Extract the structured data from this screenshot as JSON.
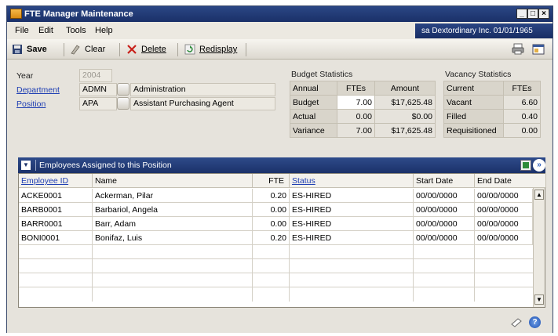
{
  "window": {
    "title": "FTE Manager Maintenance",
    "controls": [
      "_",
      "□",
      "×"
    ]
  },
  "menu": {
    "items": [
      "File",
      "Edit",
      "Tools",
      "Help"
    ],
    "user_info": "sa  Dextordinary Inc.  01/01/1965"
  },
  "toolbar": {
    "save": "Save",
    "clear": "Clear",
    "delete": "Delete",
    "redisplay": "Redisplay"
  },
  "form": {
    "year_label": "Year",
    "year_value": "2004",
    "department_label": "Department",
    "department_code": "ADMN",
    "department_name": "Administration",
    "position_label": "Position",
    "position_code": "APA",
    "position_name": "Assistant Purchasing Agent"
  },
  "budget": {
    "title": "Budget Statistics",
    "headers": [
      "Annual",
      "FTEs",
      "Amount"
    ],
    "rows": [
      {
        "label": "Budget",
        "ftes": "7.00",
        "amount": "$17,625.48"
      },
      {
        "label": "Actual",
        "ftes": "0.00",
        "amount": "$0.00"
      },
      {
        "label": "Variance",
        "ftes": "7.00",
        "amount": "$17,625.48"
      }
    ]
  },
  "vacancy": {
    "title": "Vacancy Statistics",
    "headers": [
      "Current",
      "FTEs"
    ],
    "rows": [
      {
        "label": "Vacant",
        "ftes": "6.60"
      },
      {
        "label": "Filled",
        "ftes": "0.40"
      },
      {
        "label": "Requisitioned",
        "ftes": "0.00"
      }
    ]
  },
  "grid": {
    "title": "Employees Assigned to this Position",
    "columns": [
      "Employee ID",
      "Name",
      "FTE",
      "Status",
      "Start Date",
      "End Date"
    ],
    "rows": [
      {
        "id": "ACKE0001",
        "name": "Ackerman, Pilar",
        "fte": "0.20",
        "status": "ES-HIRED",
        "start": "00/00/0000",
        "end": "00/00/0000"
      },
      {
        "id": "BARB0001",
        "name": "Barbariol, Angela",
        "fte": "0.00",
        "status": "ES-HIRED",
        "start": "00/00/0000",
        "end": "00/00/0000"
      },
      {
        "id": "BARR0001",
        "name": "Barr, Adam",
        "fte": "0.00",
        "status": "ES-HIRED",
        "start": "00/00/0000",
        "end": "00/00/0000"
      },
      {
        "id": "BONI0001",
        "name": "Bonifaz, Luis",
        "fte": "0.20",
        "status": "ES-HIRED",
        "start": "00/00/0000",
        "end": "00/00/0000"
      }
    ]
  },
  "colors": {
    "titlebar": "#1f3a78",
    "link": "#1f3fb3",
    "window_bg": "#e6e3dc"
  }
}
